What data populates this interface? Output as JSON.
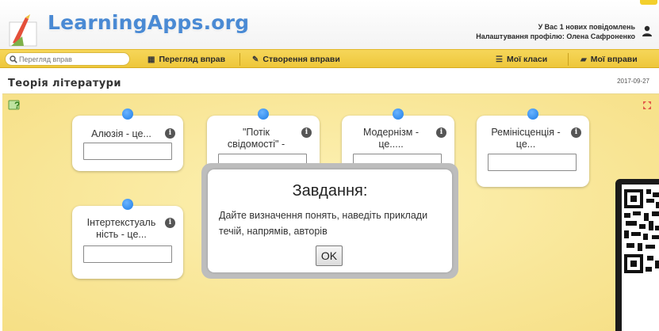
{
  "app": {
    "logo_text": "LearningApps.org",
    "messages_text": "У Вас 1 нових повідомлень",
    "profile_text": "Налаштування профілю: Олена Сафроненко"
  },
  "nav": {
    "search_placeholder": "Перегляд вправ",
    "browse_label": "Перегляд вправ",
    "create_label": "Створення вправи",
    "classes_label": "Мої класи",
    "exercises_label": "Мої вправи"
  },
  "page": {
    "title": "Теорія літератури",
    "date": "2017-09-27"
  },
  "cards": [
    {
      "label": "Алюзія - це...",
      "info": "i",
      "value": ""
    },
    {
      "label": "\"Потік свідомості\" - це...",
      "info": "i",
      "value": ""
    },
    {
      "label": "Модернізм - це.....",
      "info": "i",
      "value": ""
    },
    {
      "label": "Ремінісценція - це...",
      "info": "i",
      "value": ""
    },
    {
      "label": "Інтертекстуаль ність - це...",
      "info": "i",
      "value": ""
    }
  ],
  "modal": {
    "title": "Завдання:",
    "text": "Дайте визначення понять, наведіть приклади течій, напрямів, авторів",
    "ok_label": "OK"
  },
  "colors": {
    "brand_blue": "#4a8ad4",
    "nav_yellow": "#f2cd45",
    "board_yellow": "#f9e79a",
    "pin_blue": "#1e7ee6"
  }
}
